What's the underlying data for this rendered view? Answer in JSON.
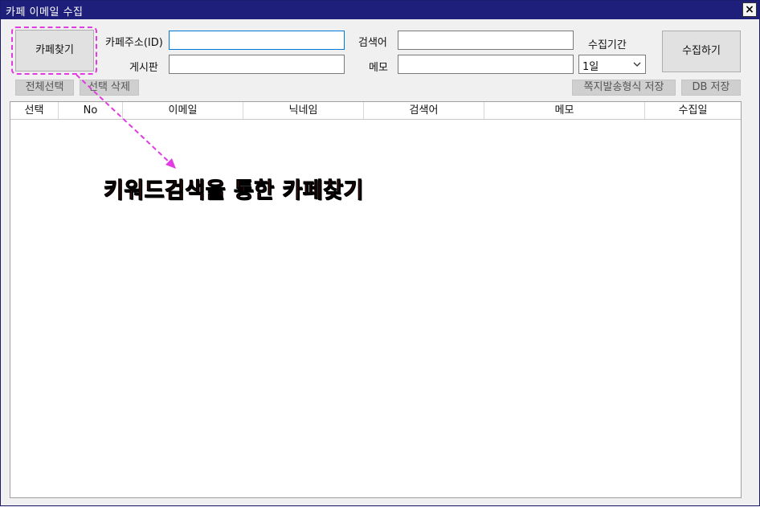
{
  "window": {
    "title": "카페 이메일 수집",
    "close_glyph": "×"
  },
  "toolbar": {
    "find_cafe_label": "카페찾기",
    "cafe_address_label": "카페주소(ID)",
    "cafe_address_value": "",
    "board_label": "게시판",
    "board_value": "",
    "keyword_label": "검색어",
    "keyword_value": "",
    "memo_label": "메모",
    "memo_value": "",
    "period_label": "수집기간",
    "period_selected": "1일",
    "collect_label": "수집하기"
  },
  "actions": {
    "select_all_label": "전체선택",
    "delete_selected_label": "선택 삭제",
    "save_message_format_label": "쪽지발송형식 저장",
    "save_db_label": "DB 저장"
  },
  "table": {
    "columns": [
      "선택",
      "No",
      "이메일",
      "닉네임",
      "검색어",
      "메모",
      "수집일"
    ],
    "rows": []
  },
  "annotation": {
    "text": "키워드검색을 통한 카페찾기",
    "color": "#e23be2",
    "text_color": "#d51f1f"
  },
  "colors": {
    "titlebar": "#1e1f7a",
    "focus_border": "#0078d7"
  },
  "icons": {
    "close": "close-icon",
    "dropdown": "chevron-down-icon"
  }
}
